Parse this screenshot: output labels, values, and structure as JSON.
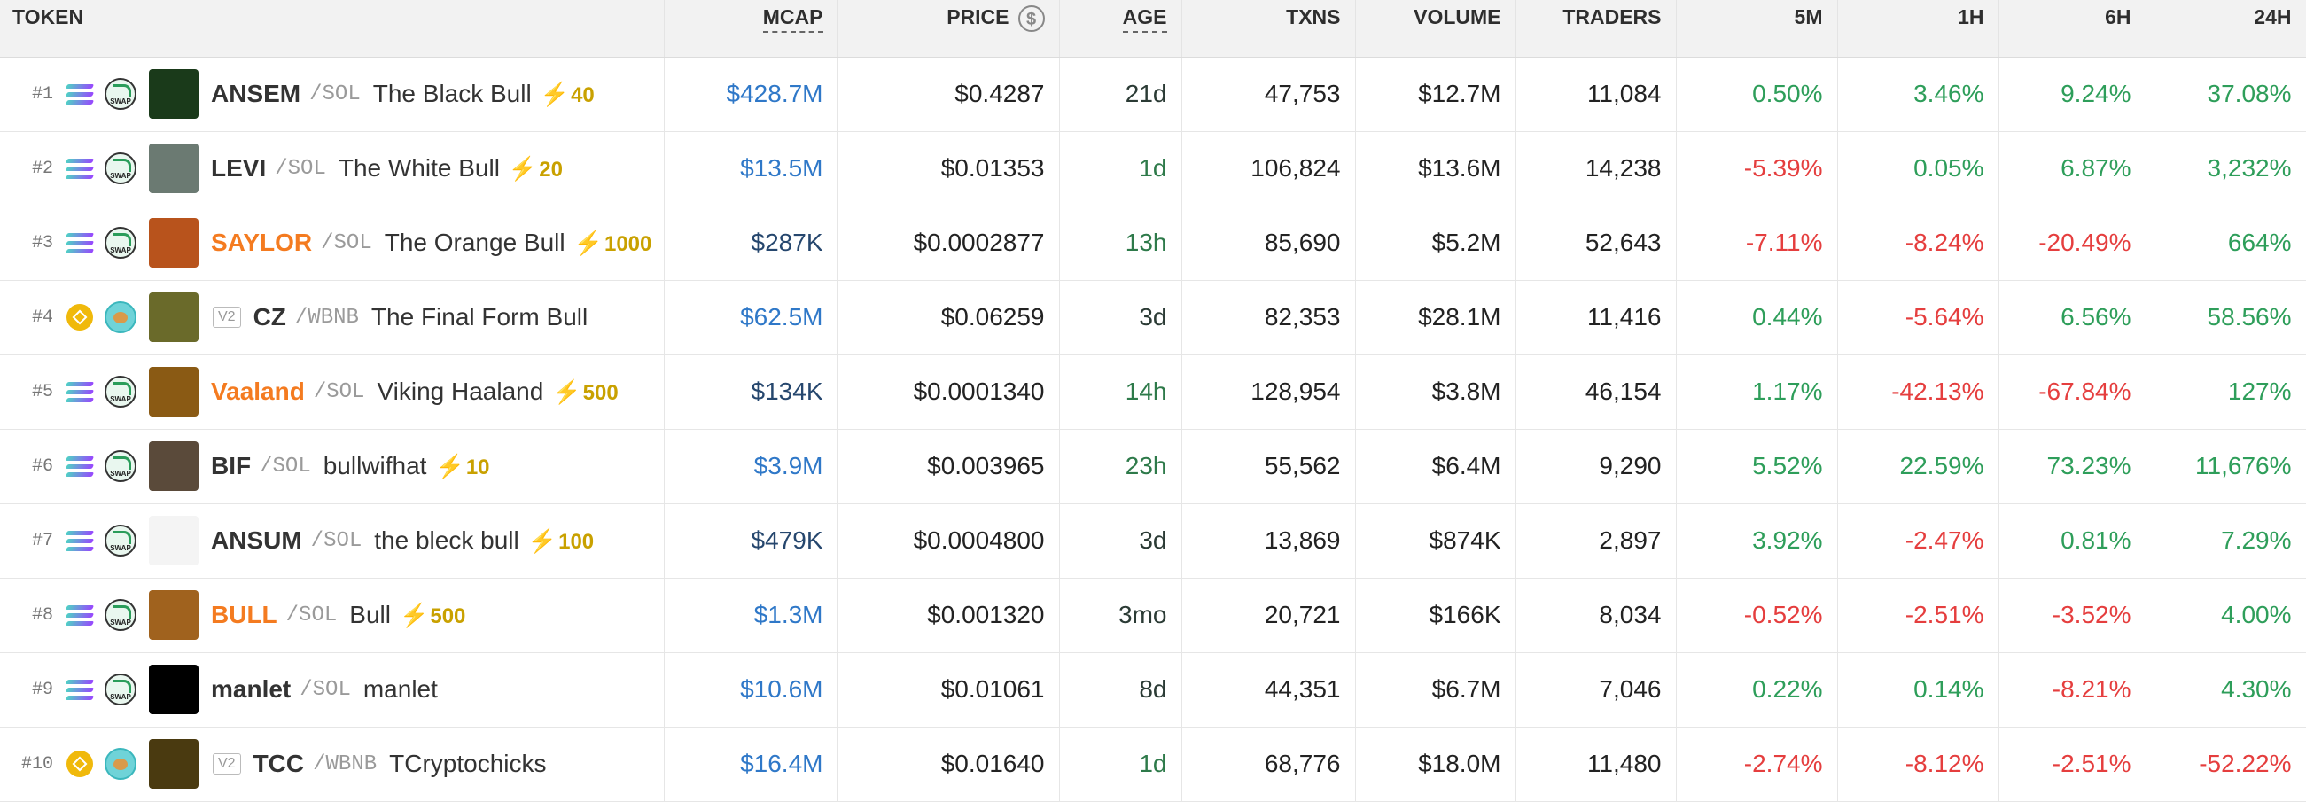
{
  "columns": {
    "token": "TOKEN",
    "mcap": "MCAP",
    "price": "PRICE",
    "age": "AGE",
    "txns": "TXNS",
    "volume": "VOLUME",
    "traders": "TRADERS",
    "m5": "5M",
    "h1": "1H",
    "h6": "6H",
    "h24": "24H"
  },
  "icons": {
    "price_currency": "usd-circle-icon",
    "boost": "lightning-bolt-icon"
  },
  "colors": {
    "positive": "#2e9e5a",
    "negative": "#e53e3e",
    "mcap_link": "#2f78c8",
    "boost": "#c9a100",
    "highlight_symbol": "#f47b20"
  },
  "rows": [
    {
      "rank": "#1",
      "chain": "SOL",
      "dex": "swap",
      "avatar_color": "#1a3a1a",
      "v2": "",
      "symbol": "ANSEM",
      "orange": false,
      "pair": "/SOL",
      "name": "The Black Bull",
      "boost": "40",
      "mcap": "$428.7M",
      "mcap_style": "blue",
      "price": "$0.4287",
      "age": "21d",
      "age_style": "dark",
      "txns": "47,753",
      "volume": "$12.7M",
      "traders": "11,084",
      "m5": "0.50%",
      "h1": "3.46%",
      "h6": "9.24%",
      "h24": "37.08%"
    },
    {
      "rank": "#2",
      "chain": "SOL",
      "dex": "swap",
      "avatar_color": "#6b7a72",
      "v2": "",
      "symbol": "LEVI",
      "orange": false,
      "pair": "/SOL",
      "name": "The White Bull",
      "boost": "20",
      "mcap": "$13.5M",
      "mcap_style": "blue",
      "price": "$0.01353",
      "age": "1d",
      "age_style": "green",
      "txns": "106,824",
      "volume": "$13.6M",
      "traders": "14,238",
      "m5": "-5.39%",
      "h1": "0.05%",
      "h6": "6.87%",
      "h24": "3,232%"
    },
    {
      "rank": "#3",
      "chain": "SOL",
      "dex": "swap",
      "avatar_color": "#b8531c",
      "v2": "",
      "symbol": "SAYLOR",
      "orange": true,
      "pair": "/SOL",
      "name": "The Orange Bull",
      "boost": "1000",
      "mcap": "$287K",
      "mcap_style": "dark",
      "price": "$0.0002877",
      "age": "13h",
      "age_style": "green",
      "txns": "85,690",
      "volume": "$5.2M",
      "traders": "52,643",
      "m5": "-7.11%",
      "h1": "-8.24%",
      "h6": "-20.49%",
      "h24": "664%"
    },
    {
      "rank": "#4",
      "chain": "BNB",
      "dex": "pancake",
      "avatar_color": "#6a6a2a",
      "v2": "V2",
      "symbol": "CZ",
      "orange": false,
      "pair": "/WBNB",
      "name": "The Final Form Bull",
      "boost": "",
      "mcap": "$62.5M",
      "mcap_style": "blue",
      "price": "$0.06259",
      "age": "3d",
      "age_style": "dark",
      "txns": "82,353",
      "volume": "$28.1M",
      "traders": "11,416",
      "m5": "0.44%",
      "h1": "-5.64%",
      "h6": "6.56%",
      "h24": "58.56%"
    },
    {
      "rank": "#5",
      "chain": "SOL",
      "dex": "swap",
      "avatar_color": "#8a5a14",
      "v2": "",
      "symbol": "Vaaland",
      "orange": true,
      "pair": "/SOL",
      "name": "Viking Haaland",
      "boost": "500",
      "mcap": "$134K",
      "mcap_style": "dark",
      "price": "$0.0001340",
      "age": "14h",
      "age_style": "green",
      "txns": "128,954",
      "volume": "$3.8M",
      "traders": "46,154",
      "m5": "1.17%",
      "h1": "-42.13%",
      "h6": "-67.84%",
      "h24": "127%"
    },
    {
      "rank": "#6",
      "chain": "SOL",
      "dex": "swap",
      "avatar_color": "#5a4a3a",
      "v2": "",
      "symbol": "BIF",
      "orange": false,
      "pair": "/SOL",
      "name": "bullwifhat",
      "boost": "10",
      "mcap": "$3.9M",
      "mcap_style": "blue",
      "price": "$0.003965",
      "age": "23h",
      "age_style": "green",
      "txns": "55,562",
      "volume": "$6.4M",
      "traders": "9,290",
      "m5": "5.52%",
      "h1": "22.59%",
      "h6": "73.23%",
      "h24": "11,676%"
    },
    {
      "rank": "#7",
      "chain": "SOL",
      "dex": "swap",
      "avatar_color": "#f4f4f4",
      "v2": "",
      "symbol": "ANSUM",
      "orange": false,
      "pair": "/SOL",
      "name": "the bleck bull",
      "boost": "100",
      "mcap": "$479K",
      "mcap_style": "dark",
      "price": "$0.0004800",
      "age": "3d",
      "age_style": "dark",
      "txns": "13,869",
      "volume": "$874K",
      "traders": "2,897",
      "m5": "3.92%",
      "h1": "-2.47%",
      "h6": "0.81%",
      "h24": "7.29%"
    },
    {
      "rank": "#8",
      "chain": "SOL",
      "dex": "swap",
      "avatar_color": "#a0621e",
      "v2": "",
      "symbol": "BULL",
      "orange": true,
      "pair": "/SOL",
      "name": "Bull",
      "boost": "500",
      "mcap": "$1.3M",
      "mcap_style": "blue",
      "price": "$0.001320",
      "age": "3mo",
      "age_style": "dark",
      "txns": "20,721",
      "volume": "$166K",
      "traders": "8,034",
      "m5": "-0.52%",
      "h1": "-2.51%",
      "h6": "-3.52%",
      "h24": "4.00%"
    },
    {
      "rank": "#9",
      "chain": "SOL",
      "dex": "swap",
      "avatar_color": "#000000",
      "v2": "",
      "symbol": "manlet",
      "orange": false,
      "pair": "/SOL",
      "name": "manlet",
      "boost": "",
      "mcap": "$10.6M",
      "mcap_style": "blue",
      "price": "$0.01061",
      "age": "8d",
      "age_style": "dark",
      "txns": "44,351",
      "volume": "$6.7M",
      "traders": "7,046",
      "m5": "0.22%",
      "h1": "0.14%",
      "h6": "-8.21%",
      "h24": "4.30%"
    },
    {
      "rank": "#10",
      "chain": "BNB",
      "dex": "pancake",
      "avatar_color": "#4a3a10",
      "v2": "V2",
      "symbol": "TCC",
      "orange": false,
      "pair": "/WBNB",
      "name": "TCryptochicks",
      "boost": "",
      "mcap": "$16.4M",
      "mcap_style": "blue",
      "price": "$0.01640",
      "age": "1d",
      "age_style": "green",
      "txns": "68,776",
      "volume": "$18.0M",
      "traders": "11,480",
      "m5": "-2.74%",
      "h1": "-8.12%",
      "h6": "-2.51%",
      "h24": "-52.22%"
    }
  ]
}
